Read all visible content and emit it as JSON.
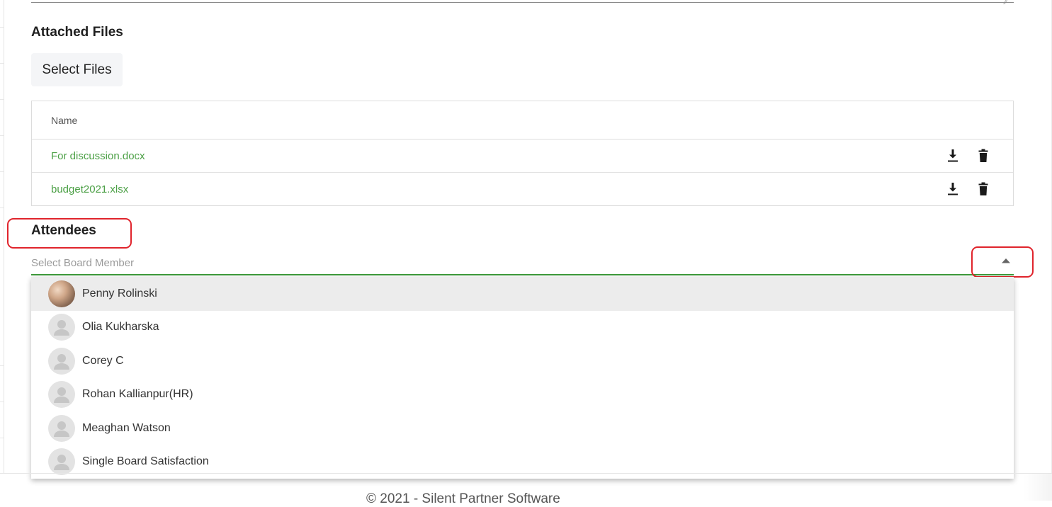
{
  "attached_files": {
    "title": "Attached Files",
    "select_button": "Select Files",
    "table_header": "Name",
    "files": [
      {
        "name": "For discussion.docx",
        "download_icon": "download-icon",
        "delete_icon": "trash-icon"
      },
      {
        "name": "budget2021.xlsx",
        "download_icon": "download-icon",
        "delete_icon": "trash-icon"
      }
    ],
    "link_color": "#4ca046"
  },
  "attendees": {
    "title": "Attendees",
    "placeholder": "Select Board Member",
    "toggle_icon": "caret-up-icon",
    "underline_color": "#3e9a3b",
    "options": [
      {
        "name": "Penny Rolinski",
        "avatar": "photo",
        "highlighted": true
      },
      {
        "name": "Olia Kukharska",
        "avatar": "default"
      },
      {
        "name": "Corey C",
        "avatar": "default"
      },
      {
        "name": "Rohan Kallianpur(HR)",
        "avatar": "default"
      },
      {
        "name": "Meaghan Watson",
        "avatar": "default"
      },
      {
        "name": "Single Board Satisfaction",
        "avatar": "default"
      }
    ]
  },
  "annotation_color": "#e0242c",
  "footer": {
    "text": "© 2021 - Silent Partner Software"
  }
}
